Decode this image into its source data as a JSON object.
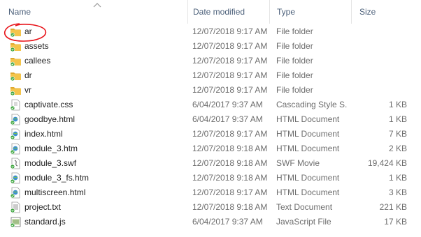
{
  "columns": {
    "name": "Name",
    "date": "Date modified",
    "type": "Type",
    "size": "Size"
  },
  "sort_icon": "chevron-up-icon",
  "files": [
    {
      "name": "ar",
      "date": "12/07/2018 9:17 AM",
      "type": "File folder",
      "size": "",
      "icon": "folder"
    },
    {
      "name": "assets",
      "date": "12/07/2018 9:17 AM",
      "type": "File folder",
      "size": "",
      "icon": "folder"
    },
    {
      "name": "callees",
      "date": "12/07/2018 9:17 AM",
      "type": "File folder",
      "size": "",
      "icon": "folder"
    },
    {
      "name": "dr",
      "date": "12/07/2018 9:17 AM",
      "type": "File folder",
      "size": "",
      "icon": "folder"
    },
    {
      "name": "vr",
      "date": "12/07/2018 9:17 AM",
      "type": "File folder",
      "size": "",
      "icon": "folder"
    },
    {
      "name": "captivate.css",
      "date": "6/04/2017 9:37 AM",
      "type": "Cascading Style S...",
      "size": "1 KB",
      "icon": "css"
    },
    {
      "name": "goodbye.html",
      "date": "6/04/2017 9:37 AM",
      "type": "HTML Document",
      "size": "1 KB",
      "icon": "html"
    },
    {
      "name": "index.html",
      "date": "12/07/2018 9:17 AM",
      "type": "HTML Document",
      "size": "7 KB",
      "icon": "html"
    },
    {
      "name": "module_3.htm",
      "date": "12/07/2018 9:18 AM",
      "type": "HTML Document",
      "size": "2 KB",
      "icon": "html"
    },
    {
      "name": "module_3.swf",
      "date": "12/07/2018 9:18 AM",
      "type": "SWF Movie",
      "size": "19,424 KB",
      "icon": "swf"
    },
    {
      "name": "module_3_fs.htm",
      "date": "12/07/2018 9:18 AM",
      "type": "HTML Document",
      "size": "1 KB",
      "icon": "html"
    },
    {
      "name": "multiscreen.html",
      "date": "12/07/2018 9:17 AM",
      "type": "HTML Document",
      "size": "3 KB",
      "icon": "html"
    },
    {
      "name": "project.txt",
      "date": "12/07/2018 9:18 AM",
      "type": "Text Document",
      "size": "221 KB",
      "icon": "txt"
    },
    {
      "name": "standard.js",
      "date": "6/04/2017 9:37 AM",
      "type": "JavaScript File",
      "size": "17 KB",
      "icon": "js"
    }
  ],
  "colors": {
    "annotation": "#e8141a",
    "sync_check": "#3aa43a",
    "folder": "#f4c44a",
    "header_text": "#4c607a"
  }
}
